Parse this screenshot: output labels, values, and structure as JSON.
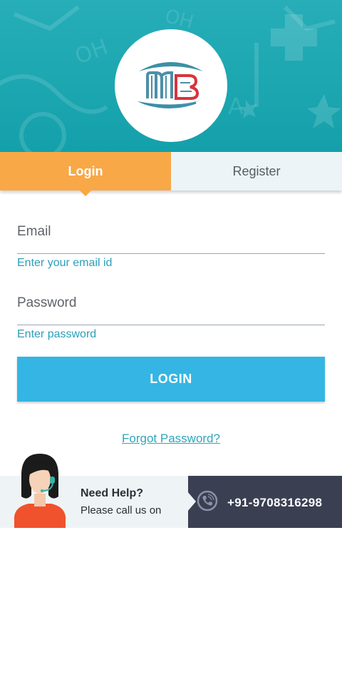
{
  "tabs": {
    "login": "Login",
    "register": "Register"
  },
  "form": {
    "email_label": "Email",
    "email_placeholder": "Enter your email id",
    "password_label": "Password",
    "password_placeholder": "Enter password",
    "login_button": "LOGIN",
    "forgot_link": "Forgot Password?"
  },
  "help": {
    "title": "Need Help?",
    "subtitle": "Please call us on",
    "phone": "+91-9708316298"
  },
  "colors": {
    "header_teal": "#1ba6b0",
    "active_tab": "#f8a847",
    "inactive_tab": "#edf4f7",
    "primary_button": "#35b5e3",
    "link": "#2fa6bd",
    "help_dark": "#3a3f52"
  },
  "icons": {
    "logo": "mb-logo-icon",
    "agent": "support-agent-icon",
    "phone": "phone-icon"
  }
}
